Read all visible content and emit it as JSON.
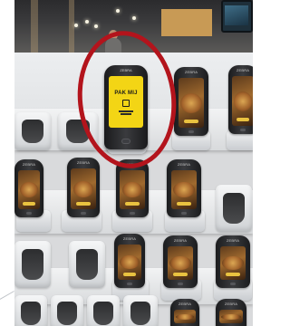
{
  "photo": {
    "subject": "self-scanning handheld scanners in charging docks",
    "highlighted_scanner": {
      "brand": "ZEBRA",
      "screen_text": "PAK MIJ",
      "screen_color": "#f3d515"
    },
    "scanner_brand": "ZEBRA",
    "annotation_color": "#b3141c"
  }
}
